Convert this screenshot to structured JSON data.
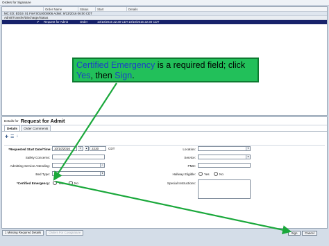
{
  "window": {
    "title": "Orders for Signature"
  },
  "orders_panel": {
    "columns": [
      "",
      "Order Name",
      "Status",
      "Start",
      "Details"
    ],
    "encounter": "MC ED; ED19; 01 Fin#:0010000006 Admit: 9/13/2016 06:00 CDT",
    "group": "Admit/Transfer/Discharge/Status",
    "order": {
      "name": "Request for Admit",
      "status": "Order",
      "start": "10/10/2016 22:30 CDT",
      "details": "10/10/2016 22:30 CDT"
    }
  },
  "details": {
    "prefix": "Details for",
    "title": "Request for Admit",
    "tabs": [
      "Details",
      "Order Comments"
    ],
    "form": {
      "start_label": "*Requested Start Date/Time:",
      "start_date": "10/10/2016",
      "start_time": "2230",
      "tz": "CDT",
      "safety_label": "Safety Concerns:",
      "admitting_label": "Admitting Service Attending:",
      "bed_label": "Bed Type:",
      "cert_label": "*Certified Emergency:",
      "yes": "Yes",
      "no": "No",
      "location_label": "Location:",
      "service_label": "Service:",
      "pmd_label": "PMD:",
      "hallway_label": "Hallway Eligible:",
      "special_label": "Special Instructions:"
    }
  },
  "footer": {
    "missing": "1 Missing Required Details",
    "cosignature": "Orders For Cosignature",
    "sign": "Sign",
    "cancel": "Cancel"
  },
  "callout": {
    "part1": "Certified Emergency",
    "part2": " is a required field; click ",
    "part3": "Yes",
    "part4": ", then ",
    "part5": "Sign",
    "part6": "."
  },
  "colors": {
    "accent": "#17226b",
    "callout": "#22c05a",
    "arrow": "#1aa83b"
  }
}
